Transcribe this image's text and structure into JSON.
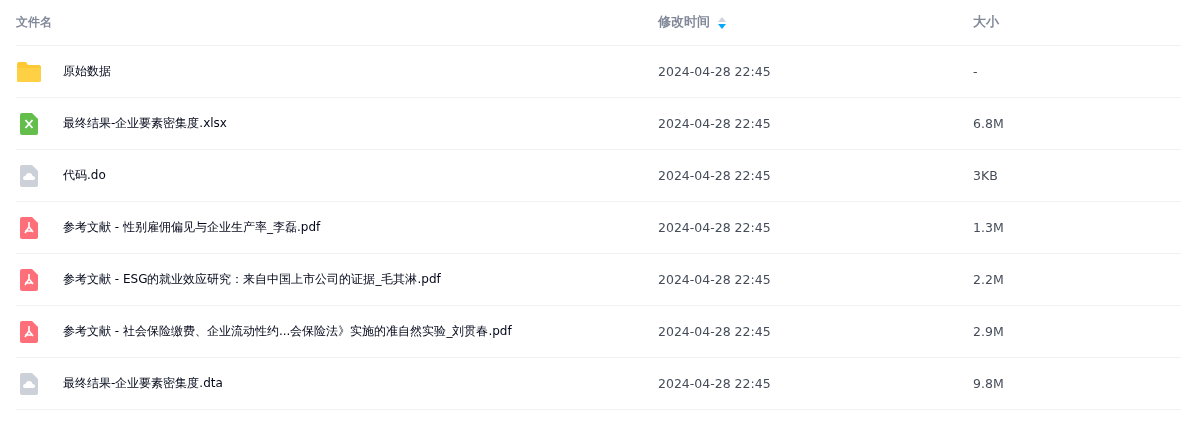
{
  "columns": [
    {
      "label": "文件名"
    },
    {
      "label": "修改时间",
      "sorted": true,
      "descending": true
    },
    {
      "label": "大小"
    }
  ],
  "files": [
    {
      "kind": "folder",
      "name": "原始数据",
      "modified": "2024-04-28 22:45",
      "size": "-"
    },
    {
      "kind": "excel",
      "name": "最终结果-企业要素密集度.xlsx",
      "modified": "2024-04-28 22:45",
      "size": "6.8M"
    },
    {
      "kind": "other",
      "name": "代码.do",
      "modified": "2024-04-28 22:45",
      "size": "3KB"
    },
    {
      "kind": "pdf",
      "name": "参考文献 - 性别雇佣偏见与企业生产率_李磊.pdf",
      "modified": "2024-04-28 22:45",
      "size": "1.3M"
    },
    {
      "kind": "pdf",
      "name": "参考文献 - ESG的就业效应研究：来自中国上市公司的证据_毛其淋.pdf",
      "modified": "2024-04-28 22:45",
      "size": "2.2M"
    },
    {
      "kind": "pdf",
      "name": "参考文献 - 社会保险缴费、企业流动性约...会保险法》实施的准自然实验_刘贯春.pdf",
      "modified": "2024-04-28 22:45",
      "size": "2.9M"
    },
    {
      "kind": "other",
      "name": "最终结果-企业要素密集度.dta",
      "modified": "2024-04-28 22:45",
      "size": "9.8M"
    }
  ]
}
